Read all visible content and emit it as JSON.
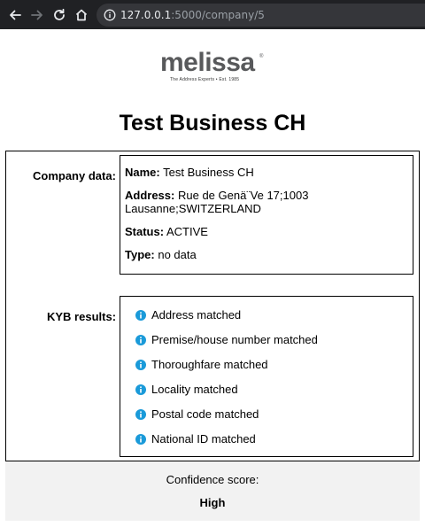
{
  "browser": {
    "url_host": "127.0.0.1",
    "url_path": ":5000/company/5"
  },
  "logo": {
    "wordmark": "melissa",
    "registered": "®",
    "tagline": "The Address Experts • Est. 1985"
  },
  "page": {
    "title": "Test Business CH"
  },
  "company": {
    "section_label": "Company data:",
    "fields": [
      {
        "label": "Name:",
        "value": "Test Business CH"
      },
      {
        "label": "Address:",
        "value": "Rue de Genä¨Ve 17;1003 Lausanne;SWITZERLAND"
      },
      {
        "label": "Status:",
        "value": "ACTIVE"
      },
      {
        "label": "Type:",
        "value": "no data"
      }
    ]
  },
  "kyb": {
    "section_label": "KYB results:",
    "results": [
      {
        "icon": "info-icon",
        "text": "Address matched"
      },
      {
        "icon": "info-icon",
        "text": "Premise/house number matched"
      },
      {
        "icon": "info-icon",
        "text": "Thoroughfare matched"
      },
      {
        "icon": "info-icon",
        "text": "Locality matched"
      },
      {
        "icon": "info-icon",
        "text": "Postal code matched"
      },
      {
        "icon": "info-icon",
        "text": "National ID matched"
      }
    ]
  },
  "confidence": {
    "label": "Confidence score:",
    "value": "High"
  },
  "colors": {
    "chrome_bg": "#202124",
    "urlbar_bg": "#35363a",
    "info_blue": "#1a9ad9",
    "score_bg": "#f2f2f2"
  }
}
